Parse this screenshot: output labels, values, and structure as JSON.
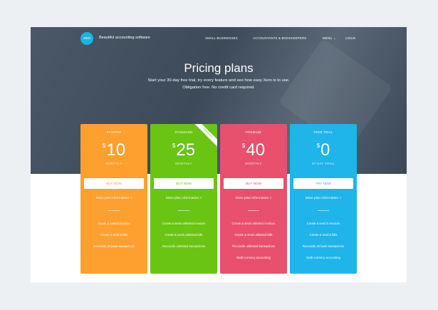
{
  "header": {
    "logo_text": "xero",
    "tagline": "Beautiful accounting software",
    "nav": [
      "SMALL BUSINESSES",
      "ACCOUNTANTS & BOOKKEEPERS",
      "MENU ⌄",
      "LOGIN"
    ]
  },
  "hero": {
    "title": "Pricing plans",
    "subtitle_line1": "Start your 30-day free trial, try every feature and see how easy Xero is to use.",
    "subtitle_line2": "Obligation free. No credit card required."
  },
  "colors": {
    "starter": "#fea02f",
    "standard": "#6ac413",
    "premium": "#e8506d",
    "free_trial": "#1fb4ea"
  },
  "plans": [
    {
      "name": "STARTER",
      "currency": "$",
      "price": "10",
      "period": "MONTHLY",
      "button": "BUY NOW",
      "more": "More plan information >",
      "features": [
        "Create & send 5 invoices",
        "Create & send 5 bills",
        "Reconcile 20 bank transactions"
      ]
    },
    {
      "name": "STANDARD",
      "badge": "POPULAR",
      "currency": "$",
      "price": "25",
      "period": "MONTHLY",
      "button": "BUY NOW",
      "more": "More plan information >",
      "features": [
        "Create & send unlimited invoices",
        "Create & send unlimited bills",
        "Reconcile unlimited transactions"
      ]
    },
    {
      "name": "PREMIUM",
      "currency": "$",
      "price": "40",
      "period": "MONTHLY",
      "button": "BUY NOW",
      "more": "More plan information >",
      "features": [
        "Create & send unlimited invoices",
        "Create & send unlimited bills",
        "Reconcile unlimited transactions",
        "Multi-currency accounting"
      ]
    },
    {
      "name": "FREE TRIAL",
      "currency": "$",
      "price": "0",
      "period": "30 DAY TRIAL",
      "button": "TRY NOW",
      "more": "More plan information >",
      "features": [
        "Create & send 5 invoices",
        "Create & send 5 bills",
        "Reconcile 20 bank transactions",
        "Multi-currency accounting"
      ]
    }
  ]
}
